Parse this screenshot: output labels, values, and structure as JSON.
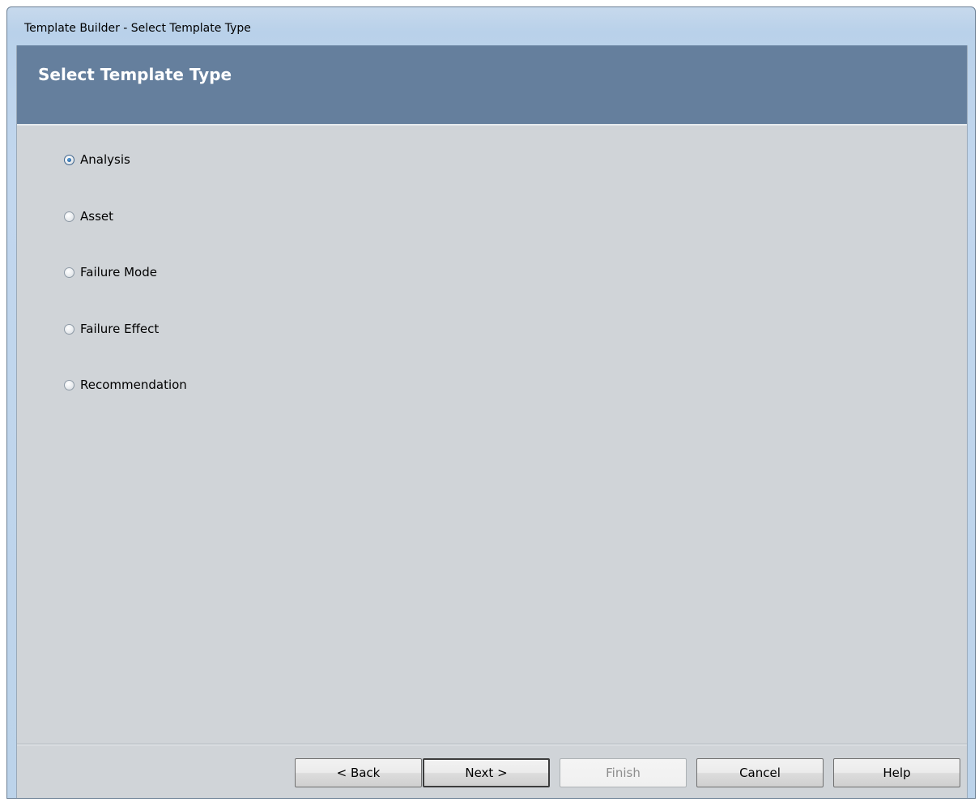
{
  "window": {
    "title": "Template Builder - Select Template Type"
  },
  "header": {
    "title": "Select Template Type"
  },
  "options": [
    {
      "label": "Analysis",
      "selected": true
    },
    {
      "label": "Asset",
      "selected": false
    },
    {
      "label": "Failure Mode",
      "selected": false
    },
    {
      "label": "Failure Effect",
      "selected": false
    },
    {
      "label": "Recommendation",
      "selected": false
    }
  ],
  "buttons": {
    "back": {
      "label": "< Back",
      "enabled": true
    },
    "next": {
      "label": "Next >",
      "enabled": true,
      "default": true
    },
    "finish": {
      "label": "Finish",
      "enabled": false
    },
    "cancel": {
      "label": "Cancel",
      "enabled": true
    },
    "help": {
      "label": "Help",
      "enabled": true
    }
  },
  "colors": {
    "header_band": "#657f9d",
    "content_bg": "#d0d4d8",
    "selected_radio": "#1f5d99"
  }
}
